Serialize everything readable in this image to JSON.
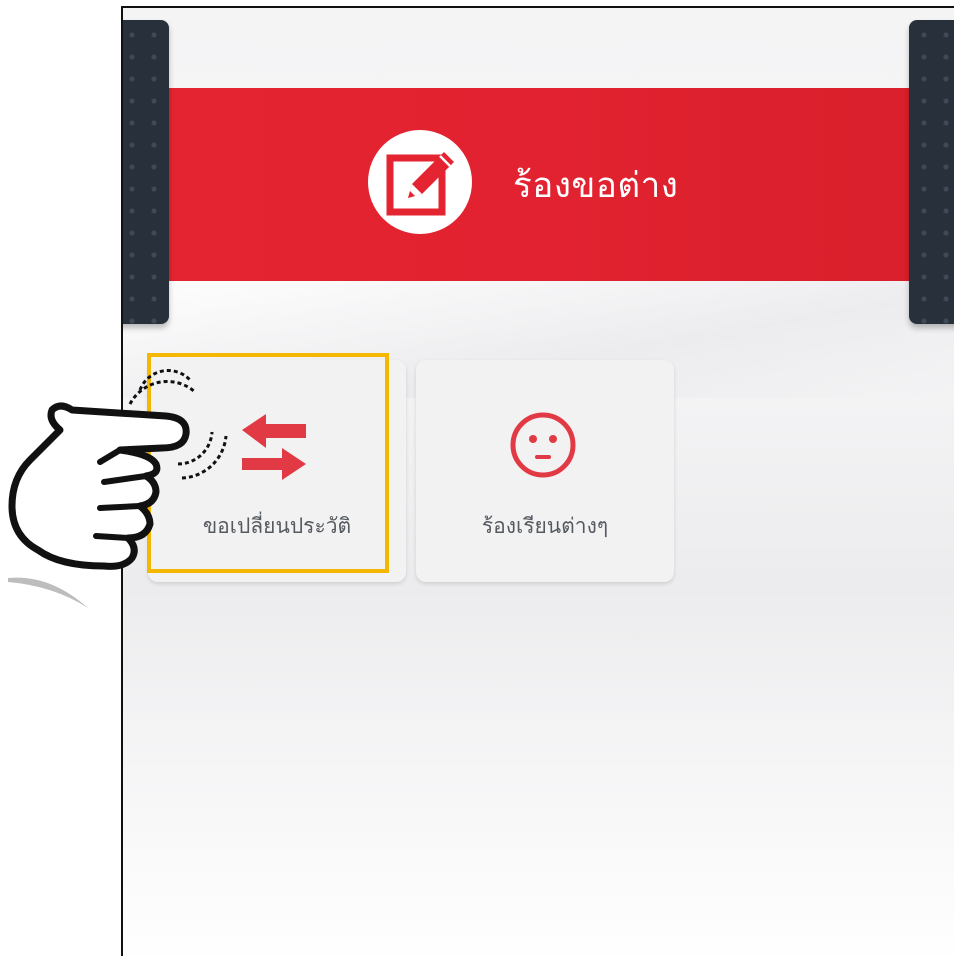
{
  "banner": {
    "title": "ร้องขอต่าง",
    "icon": "edit-note-icon",
    "color": "#e52431"
  },
  "menu": {
    "items": [
      {
        "label": "ขอเปลี่ยนประวัติ",
        "icon": "swap-arrows-icon",
        "selected": true
      },
      {
        "label": "ร้องเรียนต่างๆ",
        "icon": "neutral-face-icon",
        "selected": false
      }
    ]
  },
  "colors": {
    "accent_red": "#e23a45",
    "highlight": "#f5b800",
    "side_tab": "#27303b"
  },
  "overlay": {
    "pointer": "pointing-hand-icon"
  }
}
